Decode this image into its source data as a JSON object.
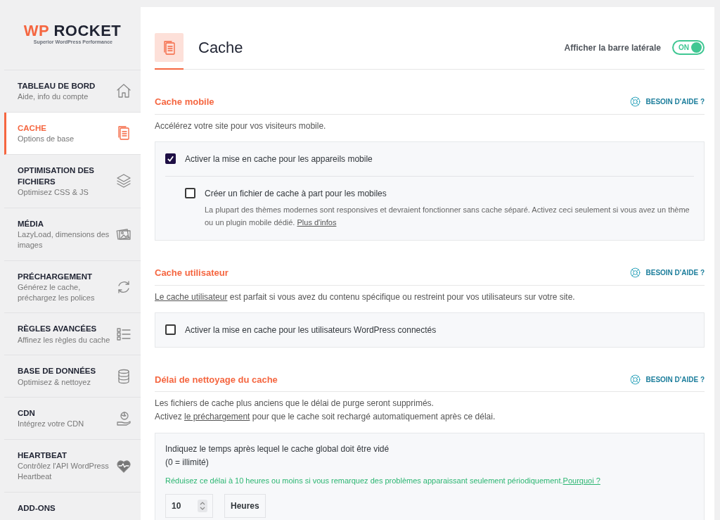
{
  "logo": {
    "mark": "WP",
    "name": "ROCKET",
    "tagline": "Superior WordPress Performance"
  },
  "sidebar": {
    "items": [
      {
        "title": "TABLEAU DE BORD",
        "subtitle": "Aide, info du compte",
        "selected": false
      },
      {
        "title": "CACHE",
        "subtitle": "Options de base",
        "selected": true
      },
      {
        "title": "OPTIMISATION DES FICHIERS",
        "subtitle": "Optimisez CSS & JS",
        "selected": false
      },
      {
        "title": "MÉDIA",
        "subtitle": "LazyLoad, dimensions des images",
        "selected": false
      },
      {
        "title": "PRÉCHARGEMENT",
        "subtitle": "Générez le cache, préchargez les polices",
        "selected": false
      },
      {
        "title": "RÈGLES AVANCÉES",
        "subtitle": "Affinez les règles du cache",
        "selected": false
      },
      {
        "title": "BASE DE DONNÉES",
        "subtitle": "Optimisez & nettoyez",
        "selected": false
      },
      {
        "title": "CDN",
        "subtitle": "Intégrez votre CDN",
        "selected": false
      },
      {
        "title": "HEARTBEAT",
        "subtitle": "Contrôlez l'API WordPress Heartbeat",
        "selected": false
      },
      {
        "title": "ADD-ONS",
        "selected": false
      }
    ]
  },
  "header": {
    "title": "Cache",
    "sidebar_toggle": {
      "label": "Afficher la barre latérale",
      "state_text": "ON",
      "on": true
    }
  },
  "sections": [
    {
      "title": "Cache mobile",
      "help": "BESOIN D'AIDE ?",
      "description": [
        [
          {
            "text": "Accélérez votre site pour vos visiteurs mobile."
          }
        ]
      ],
      "panel": {
        "kind": "options",
        "options": [
          {
            "label": "Activer la mise en cache pour les appareils mobile",
            "checked": true,
            "nested": false
          },
          {
            "label": "Créer un fichier de cache à part pour les mobiles",
            "checked": false,
            "nested": true,
            "help": [
              {
                "text": "La plupart des thèmes modernes sont responsives et devraient fonctionner sans cache séparé. Activez ceci seulement si vous avez un thème ou un plugin mobile dédié. "
              },
              {
                "text": "Plus d'infos",
                "link": true
              }
            ]
          }
        ]
      }
    },
    {
      "title": "Cache utilisateur",
      "help": "BESOIN D'AIDE ?",
      "description": [
        [
          {
            "text": "Le cache utilisateur",
            "link": true
          },
          {
            "text": " est parfait si vous avez du contenu spécifique ou restreint pour vos utilisateurs sur votre site."
          }
        ]
      ],
      "panel": {
        "kind": "options",
        "options": [
          {
            "label": "Activer la mise en cache pour les utilisateurs WordPress connectés",
            "checked": false,
            "nested": false
          }
        ]
      }
    },
    {
      "title": "Délai de nettoyage du cache",
      "help": "BESOIN D'AIDE ?",
      "description": [
        [
          {
            "text": "Les fichiers de cache plus anciens que le délai de purge seront supprimés."
          }
        ],
        [
          {
            "text": "Activez "
          },
          {
            "text": "le préchargement",
            "link": true
          },
          {
            "text": " pour que le cache soit rechargé automatiquement après ce délai."
          }
        ]
      ],
      "panel": {
        "kind": "lifespan",
        "label": "Indiquez le temps après lequel le cache global doit être vidé",
        "note": "(0 = illimité)",
        "hint": [
          {
            "text": "Réduisez ce délai à 10 heures ou moins si vous remarquez des problèmes apparaissant seulement périodiquement."
          },
          {
            "text": "Pourquoi ?",
            "link": true
          }
        ],
        "value": "10",
        "unit": "Heures"
      }
    }
  ]
}
